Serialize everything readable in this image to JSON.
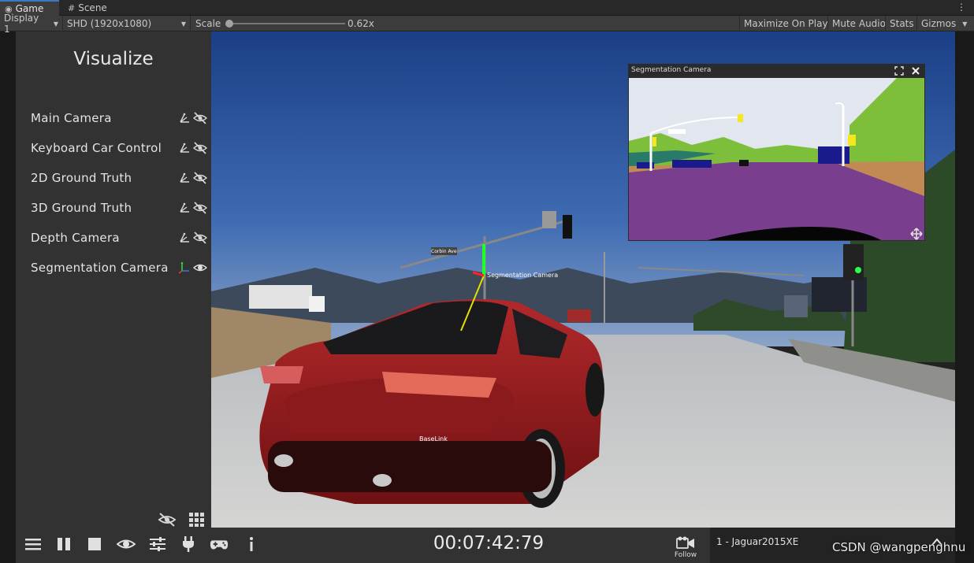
{
  "tabs": [
    {
      "label": "Game",
      "icon": "gamepad-icon",
      "active": true
    },
    {
      "label": "Scene",
      "icon": "grid-icon",
      "active": false
    }
  ],
  "toolbar": {
    "display": "Display 1",
    "resolution": "SHD (1920x1080)",
    "scale_label": "Scale",
    "scale_value": "0.62x",
    "maximize": "Maximize On Play",
    "mute": "Mute Audio",
    "stats": "Stats",
    "gizmos": "Gizmos"
  },
  "visualize": {
    "title": "Visualize",
    "items": [
      {
        "label": "Main Camera",
        "axes_icon": "axes-icon",
        "visibility_icon": "eye-off-icon"
      },
      {
        "label": "Keyboard Car Control",
        "axes_icon": "axes-icon",
        "visibility_icon": "eye-off-icon"
      },
      {
        "label": "2D Ground Truth",
        "axes_icon": "axes-icon",
        "visibility_icon": "eye-off-icon"
      },
      {
        "label": "3D Ground Truth",
        "axes_icon": "axes-icon",
        "visibility_icon": "eye-off-icon"
      },
      {
        "label": "Depth Camera",
        "axes_icon": "axes-icon",
        "visibility_icon": "eye-off-icon"
      },
      {
        "label": "Segmentation Camera",
        "axes_icon": "axes-colored-icon",
        "visibility_icon": "eye-icon"
      }
    ]
  },
  "bottom_bar": {
    "timer": "00:07:42:79",
    "follow_label": "Follow",
    "vehicle": "1 - Jaguar2015XE",
    "icons": [
      "menu-icon",
      "pause-icon",
      "stop-icon",
      "eye-icon",
      "sliders-icon",
      "plug-icon",
      "gamepad-icon",
      "info-icon"
    ]
  },
  "segmentation_window": {
    "title": "Segmentation Camera"
  },
  "scene_labels": {
    "street_sign": "Corbin Ave",
    "seg_camera_label": "Segmentation Camera",
    "baselink": "BaseLink"
  },
  "watermark": "CSDN @wangpenghnu",
  "colors": {
    "accent": "#3a79bb",
    "panel": "#323232",
    "seg_road": "#7a3e8f",
    "seg_vegetation": "#7dbf3a",
    "seg_sky": "#e1e6ef",
    "seg_car": "#1a1a8c",
    "seg_sign": "#f5e61e"
  }
}
